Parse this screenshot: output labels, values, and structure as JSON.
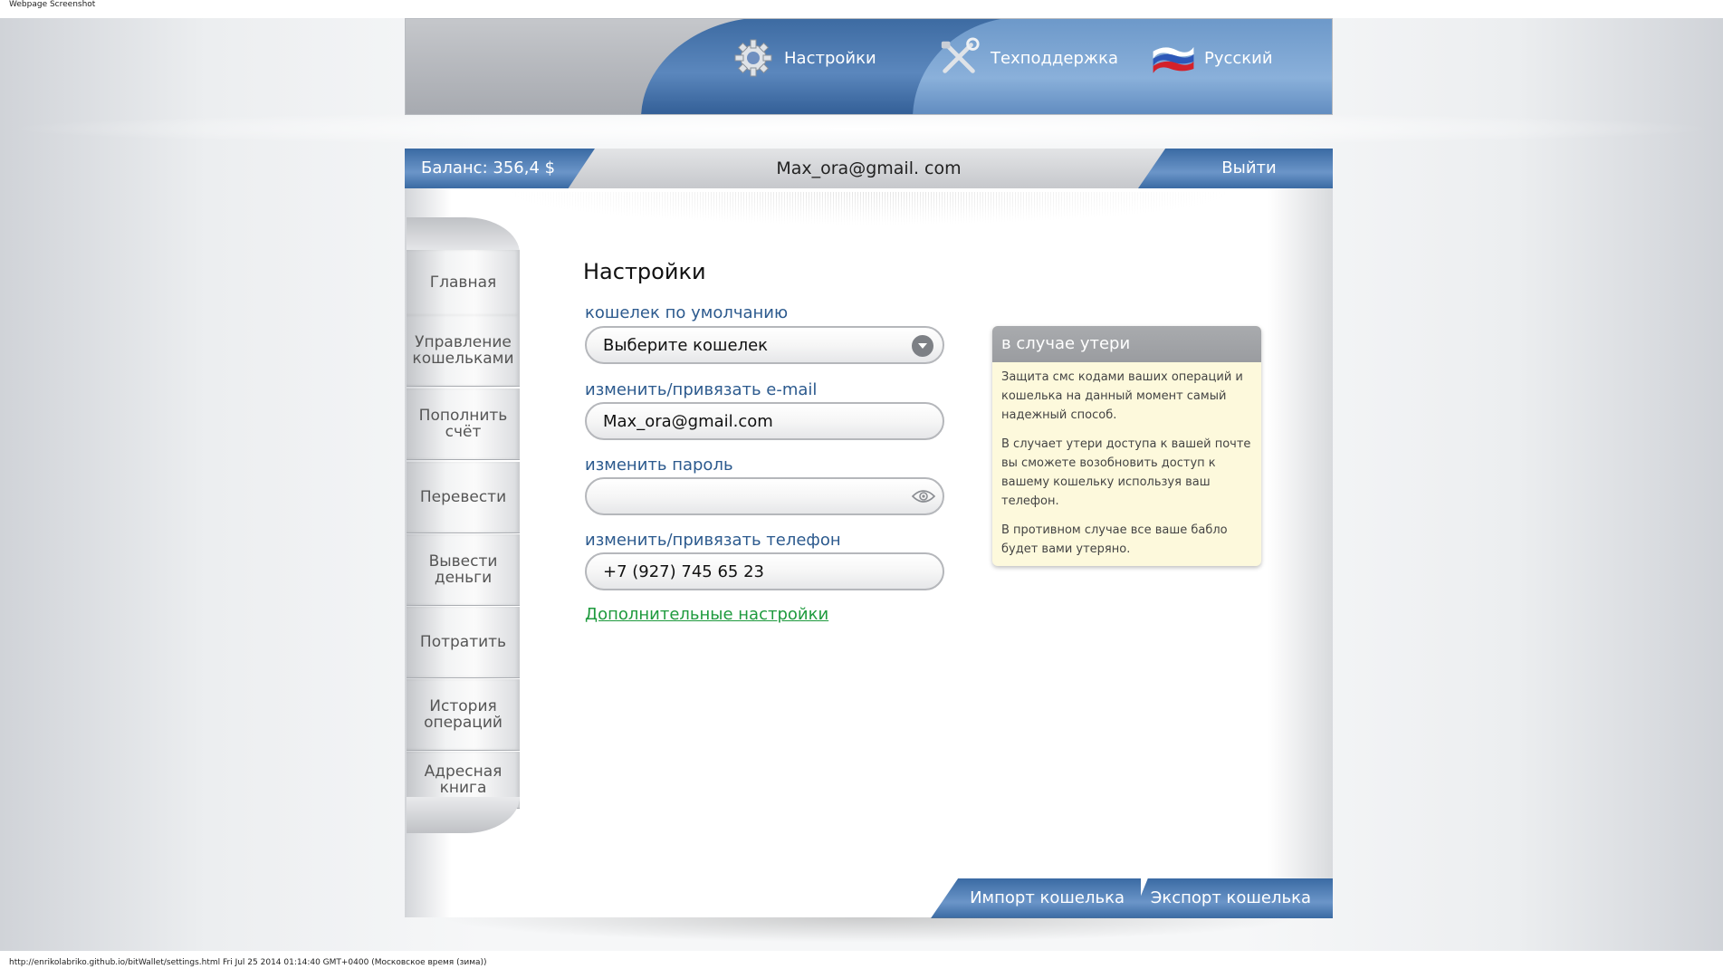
{
  "caption": "Webpage Screenshot",
  "header": {
    "settings_label": "Настройки",
    "support_label": "Техподдержка",
    "language_label": "Русский"
  },
  "topbar": {
    "balance": "Баланс: 356,4 $",
    "user_email": "Max_ora@gmail. com",
    "logout_label": "Выйти"
  },
  "sidebar": {
    "items": [
      {
        "label": "Главная"
      },
      {
        "label": "Управление кошельками"
      },
      {
        "label": "Пополнить счёт"
      },
      {
        "label": "Перевести"
      },
      {
        "label": "Вывести деньги"
      },
      {
        "label": "Потратить"
      },
      {
        "label": "История операций"
      },
      {
        "label": "Адресная книга"
      }
    ]
  },
  "main": {
    "title": "Настройки",
    "wallet_label": "кошелек по умолчанию",
    "wallet_value": "Выберите кошелек",
    "email_label": "изменить/привязать e-mail",
    "email_value": "Max_ora@gmail.com",
    "password_label": "изменить пароль",
    "password_value": "",
    "phone_label": "изменить/привязать телефон",
    "phone_value": "+7 (927) 745 65 23",
    "advanced_link": "Дополнительные настройки"
  },
  "info": {
    "title": "в случае утери",
    "paragraphs": [
      "Защита смс кодами ваших операций и кошелька на данный момент самый надежный способ.",
      "В случает утери доступа к вашей почте вы сможете возобновить доступ к вашему кошельку используя ваш телефон.",
      "В противном случае все ваше бабло будет вами утеряно."
    ]
  },
  "bottom": {
    "import_label": "Импорт кошелька",
    "export_label": "Экспорт кошелька"
  },
  "footer": "http://enrikolabriko.github.io/bitWallet/settings.html Fri Jul 25 2014 01:14:40 GMT+0400 (Московское время (зима))",
  "colors": {
    "accent_blue": "#3a6aa3",
    "label_blue": "#2c5a8e",
    "link_green": "#1e9a3d",
    "info_bg": "#fdf9dc"
  }
}
